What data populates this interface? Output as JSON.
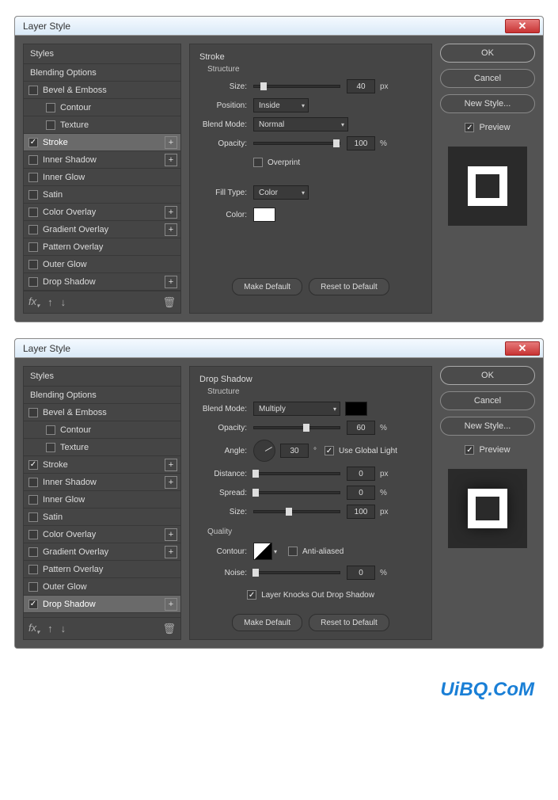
{
  "watermark": "UiBQ.CoM",
  "dialog1": {
    "title": "Layer Style",
    "styles_header": "Styles",
    "blending": "Blending Options",
    "items": [
      {
        "label": "Bevel & Emboss",
        "checked": false,
        "plus": false,
        "indent": 0
      },
      {
        "label": "Contour",
        "checked": false,
        "plus": false,
        "indent": 1
      },
      {
        "label": "Texture",
        "checked": false,
        "plus": false,
        "indent": 1
      },
      {
        "label": "Stroke",
        "checked": true,
        "plus": true,
        "indent": 0,
        "selected": true
      },
      {
        "label": "Inner Shadow",
        "checked": false,
        "plus": true,
        "indent": 0
      },
      {
        "label": "Inner Glow",
        "checked": false,
        "plus": false,
        "indent": 0
      },
      {
        "label": "Satin",
        "checked": false,
        "plus": false,
        "indent": 0
      },
      {
        "label": "Color Overlay",
        "checked": false,
        "plus": true,
        "indent": 0
      },
      {
        "label": "Gradient Overlay",
        "checked": false,
        "plus": true,
        "indent": 0
      },
      {
        "label": "Pattern Overlay",
        "checked": false,
        "plus": false,
        "indent": 0
      },
      {
        "label": "Outer Glow",
        "checked": false,
        "plus": false,
        "indent": 0
      },
      {
        "label": "Drop Shadow",
        "checked": false,
        "plus": true,
        "indent": 0
      }
    ],
    "section": "Stroke",
    "structure": "Structure",
    "size_lbl": "Size:",
    "size_val": "40",
    "size_unit": "px",
    "position_lbl": "Position:",
    "position_val": "Inside",
    "blend_lbl": "Blend Mode:",
    "blend_val": "Normal",
    "opacity_lbl": "Opacity:",
    "opacity_val": "100",
    "opacity_unit": "%",
    "overprint": "Overprint",
    "filltype_lbl": "Fill Type:",
    "filltype_val": "Color",
    "color_lbl": "Color:",
    "color_hex": "#ffffff",
    "make_default": "Make Default",
    "reset_default": "Reset to Default",
    "ok": "OK",
    "cancel": "Cancel",
    "newstyle": "New Style...",
    "preview": "Preview"
  },
  "dialog2": {
    "title": "Layer Style",
    "styles_header": "Styles",
    "blending": "Blending Options",
    "items": [
      {
        "label": "Bevel & Emboss",
        "checked": false,
        "plus": false,
        "indent": 0
      },
      {
        "label": "Contour",
        "checked": false,
        "plus": false,
        "indent": 1
      },
      {
        "label": "Texture",
        "checked": false,
        "plus": false,
        "indent": 1
      },
      {
        "label": "Stroke",
        "checked": true,
        "plus": true,
        "indent": 0
      },
      {
        "label": "Inner Shadow",
        "checked": false,
        "plus": true,
        "indent": 0
      },
      {
        "label": "Inner Glow",
        "checked": false,
        "plus": false,
        "indent": 0
      },
      {
        "label": "Satin",
        "checked": false,
        "plus": false,
        "indent": 0
      },
      {
        "label": "Color Overlay",
        "checked": false,
        "plus": true,
        "indent": 0
      },
      {
        "label": "Gradient Overlay",
        "checked": false,
        "plus": true,
        "indent": 0
      },
      {
        "label": "Pattern Overlay",
        "checked": false,
        "plus": false,
        "indent": 0
      },
      {
        "label": "Outer Glow",
        "checked": false,
        "plus": false,
        "indent": 0
      },
      {
        "label": "Drop Shadow",
        "checked": true,
        "plus": true,
        "indent": 0,
        "selected": true
      }
    ],
    "section": "Drop Shadow",
    "structure": "Structure",
    "blend_lbl": "Blend Mode:",
    "blend_val": "Multiply",
    "blend_color": "#000000",
    "opacity_lbl": "Opacity:",
    "opacity_val": "60",
    "opacity_unit": "%",
    "angle_lbl": "Angle:",
    "angle_val": "30",
    "angle_unit": "°",
    "use_global": "Use Global Light",
    "distance_lbl": "Distance:",
    "distance_val": "0",
    "distance_unit": "px",
    "spread_lbl": "Spread:",
    "spread_val": "0",
    "spread_unit": "%",
    "size_lbl": "Size:",
    "size_val": "100",
    "size_unit": "px",
    "quality": "Quality",
    "contour_lbl": "Contour:",
    "antialias": "Anti-aliased",
    "noise_lbl": "Noise:",
    "noise_val": "0",
    "noise_unit": "%",
    "knocks": "Layer Knocks Out Drop Shadow",
    "make_default": "Make Default",
    "reset_default": "Reset to Default",
    "ok": "OK",
    "cancel": "Cancel",
    "newstyle": "New Style...",
    "preview": "Preview"
  }
}
